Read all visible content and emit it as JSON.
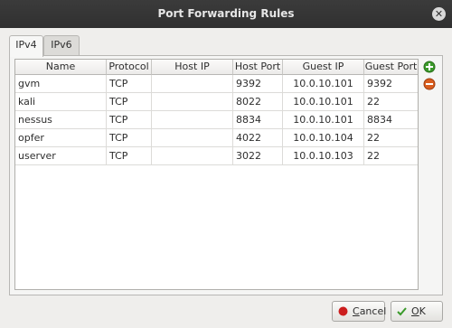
{
  "dialog": {
    "title": "Port Forwarding Rules"
  },
  "tabs": [
    {
      "label": "IPv4"
    },
    {
      "label": "IPv6"
    }
  ],
  "table": {
    "headers": [
      "Name",
      "Protocol",
      "Host IP",
      "Host Port",
      "Guest IP",
      "Guest Port"
    ],
    "rows": [
      [
        "gvm",
        "TCP",
        "",
        "9392",
        "10.0.10.101",
        "9392"
      ],
      [
        "kali",
        "TCP",
        "",
        "8022",
        "10.0.10.101",
        "22"
      ],
      [
        "nessus",
        "TCP",
        "",
        "8834",
        "10.0.10.101",
        "8834"
      ],
      [
        "opfer",
        "TCP",
        "",
        "4022",
        "10.0.10.104",
        "22"
      ],
      [
        "userver",
        "TCP",
        "",
        "3022",
        "10.0.10.103",
        "22"
      ]
    ]
  },
  "side_buttons": [
    {
      "icon": "add-rule-icon"
    },
    {
      "icon": "remove-rule-icon"
    }
  ],
  "buttons": {
    "cancel_mnemonic": "C",
    "cancel_rest": "ancel",
    "ok_mnemonic": "O",
    "ok_rest": "K"
  },
  "colors": {
    "titlebar": "#303030",
    "window": "#efeeec",
    "add": "#3a9a2a",
    "remove": "#d95d1e",
    "cancel": "#cc1e1e"
  }
}
